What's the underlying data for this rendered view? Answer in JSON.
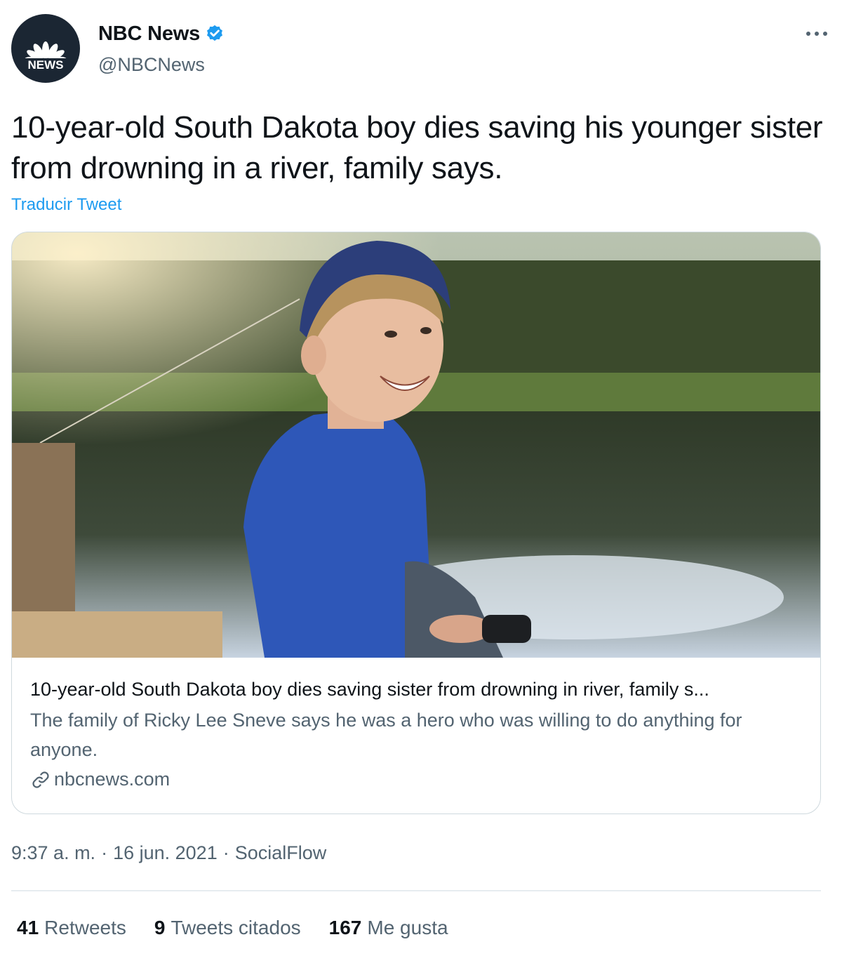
{
  "author": {
    "display_name": "NBC News",
    "handle": "@NBCNews",
    "avatar_label": "NEWS"
  },
  "tweet": {
    "text": "10-year-old South Dakota boy dies saving his younger sister from drowning in a river, family says.",
    "translate_label": "Traducir Tweet"
  },
  "card": {
    "title": "10-year-old South Dakota boy dies saving sister from drowning in river, family s...",
    "description": "The family of Ricky Lee Sneve says he was a hero who was willing to do anything for anyone.",
    "domain": "nbcnews.com"
  },
  "meta": {
    "time": "9:37 a. m.",
    "sep1": "·",
    "date": "16 jun. 2021",
    "sep2": "·",
    "source": "SocialFlow"
  },
  "stats": {
    "retweets_count": "41",
    "retweets_label": "Retweets",
    "quotes_count": "9",
    "quotes_label": "Tweets citados",
    "likes_count": "167",
    "likes_label": "Me gusta"
  },
  "colors": {
    "accent": "#1d9bf0",
    "secondary_text": "#536471",
    "primary_text": "#0f1419",
    "border": "#cfd9de"
  },
  "icons": [
    "nbc-peacock-icon",
    "verified-badge-icon",
    "more-options-icon",
    "link-icon"
  ]
}
